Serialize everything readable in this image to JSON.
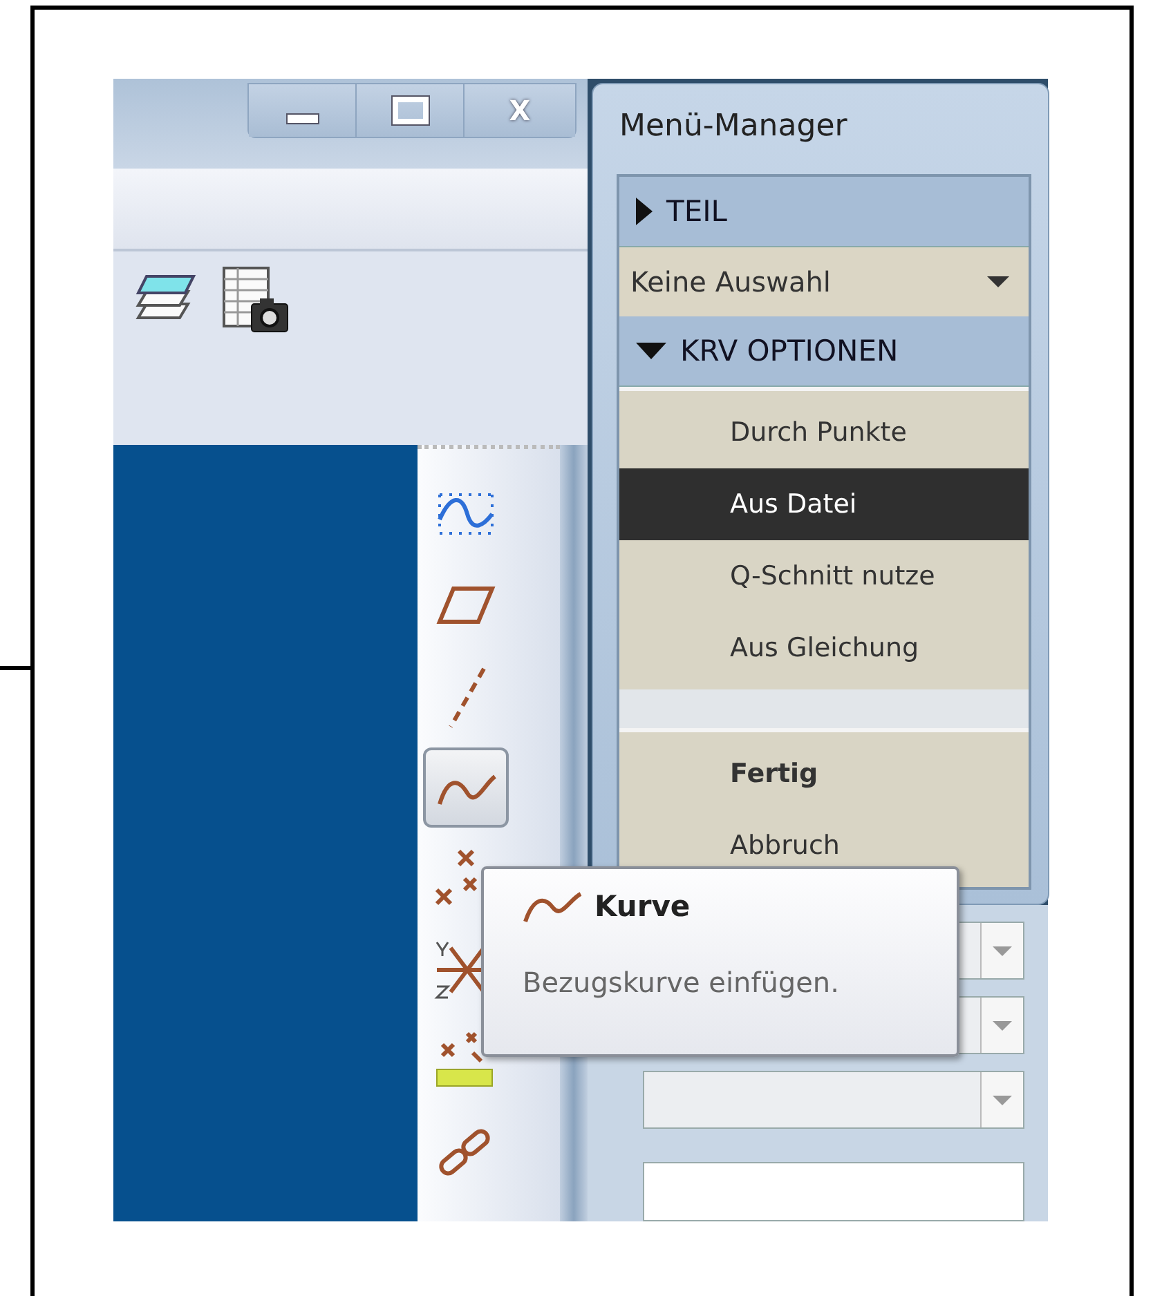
{
  "window_buttons": [
    {
      "kind": "minimize"
    },
    {
      "kind": "maximize"
    },
    {
      "kind": "close",
      "label": "X"
    }
  ],
  "toolbar_icons": [
    {
      "kind": "layers"
    },
    {
      "kind": "table-camera"
    }
  ],
  "tools": [
    {
      "kind": "sketch",
      "selected": false
    },
    {
      "kind": "plane",
      "selected": false
    },
    {
      "kind": "axis",
      "selected": false
    },
    {
      "kind": "curve",
      "selected": true
    },
    {
      "kind": "point",
      "selected": false
    },
    {
      "kind": "csys",
      "selected": false
    },
    {
      "kind": "ruler-point",
      "selected": false
    },
    {
      "kind": "chain",
      "selected": false
    }
  ],
  "menu_manager": {
    "title": "Menü-Manager",
    "sections": [
      {
        "kind": "header",
        "label": "TEIL",
        "expanded": false
      },
      {
        "kind": "dropdown",
        "label": "Keine Auswahl"
      },
      {
        "kind": "header",
        "label": "KRV OPTIONEN",
        "expanded": true
      }
    ],
    "groups": [
      [
        {
          "label": "Durch Punkte",
          "selected": false,
          "kind": "option"
        },
        {
          "label": "Aus Datei",
          "selected": true,
          "kind": "option"
        },
        {
          "label": "Q-Schnitt nutze",
          "selected": false,
          "kind": "option"
        },
        {
          "label": "Aus Gleichung",
          "selected": false,
          "kind": "option"
        }
      ],
      [
        {
          "label": "Fertig",
          "selected": false,
          "kind": "default"
        },
        {
          "label": "Abbruch",
          "selected": false,
          "kind": "option"
        }
      ]
    ]
  },
  "tooltip": {
    "title": "Kurve",
    "text": "Bezugskurve einfügen."
  }
}
